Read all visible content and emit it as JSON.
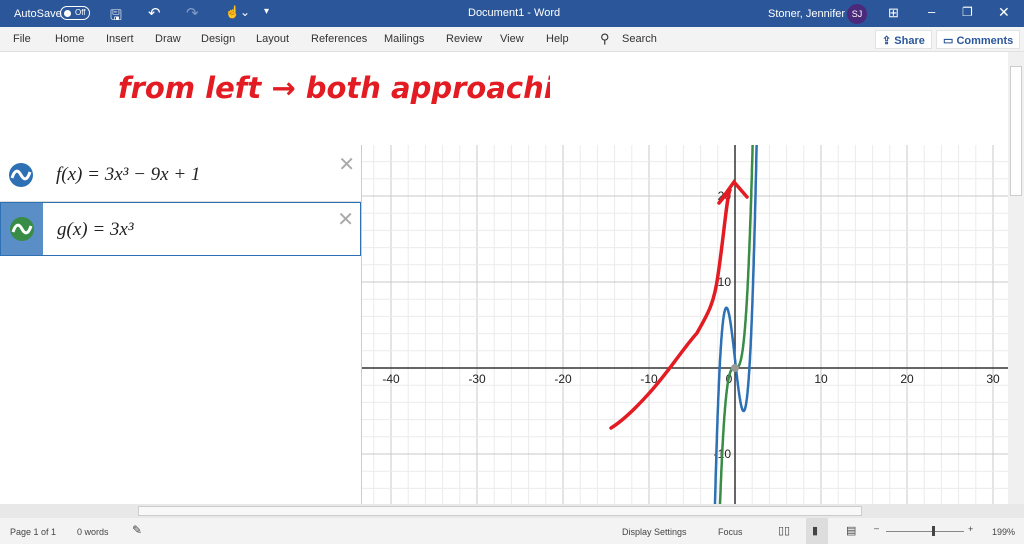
{
  "titlebar": {
    "autosave": "AutoSave",
    "toggle": "Off",
    "doc_title": "Document1  -  Word",
    "user": "Stoner, Jennifer L",
    "initials": "SJ"
  },
  "menu": {
    "items": [
      "File",
      "Home",
      "Insert",
      "Draw",
      "Design",
      "Layout",
      "References",
      "Mailings",
      "Review",
      "View",
      "Help"
    ],
    "search": "Search",
    "share": "Share",
    "comments": "Comments"
  },
  "handwriting": "from left → both approaching",
  "expressions": [
    {
      "text": "f(x) = 3x³ − 9x + 1",
      "color": "#2d70b3"
    },
    {
      "text": "g(x) = 3x³",
      "color": "#388c46"
    }
  ],
  "graph": {
    "x_ticks": [
      "-40",
      "-30",
      "-20",
      "-10",
      "0",
      "10",
      "20",
      "30"
    ],
    "y_ticks": [
      "20",
      "10",
      "-10"
    ],
    "x_range": [
      -40,
      31
    ],
    "y_range": [
      -16,
      26
    ]
  },
  "status": {
    "page": "Page 1 of 1",
    "words": "0 words",
    "display": "Display Settings",
    "focus": "Focus",
    "zoom": "199%"
  }
}
